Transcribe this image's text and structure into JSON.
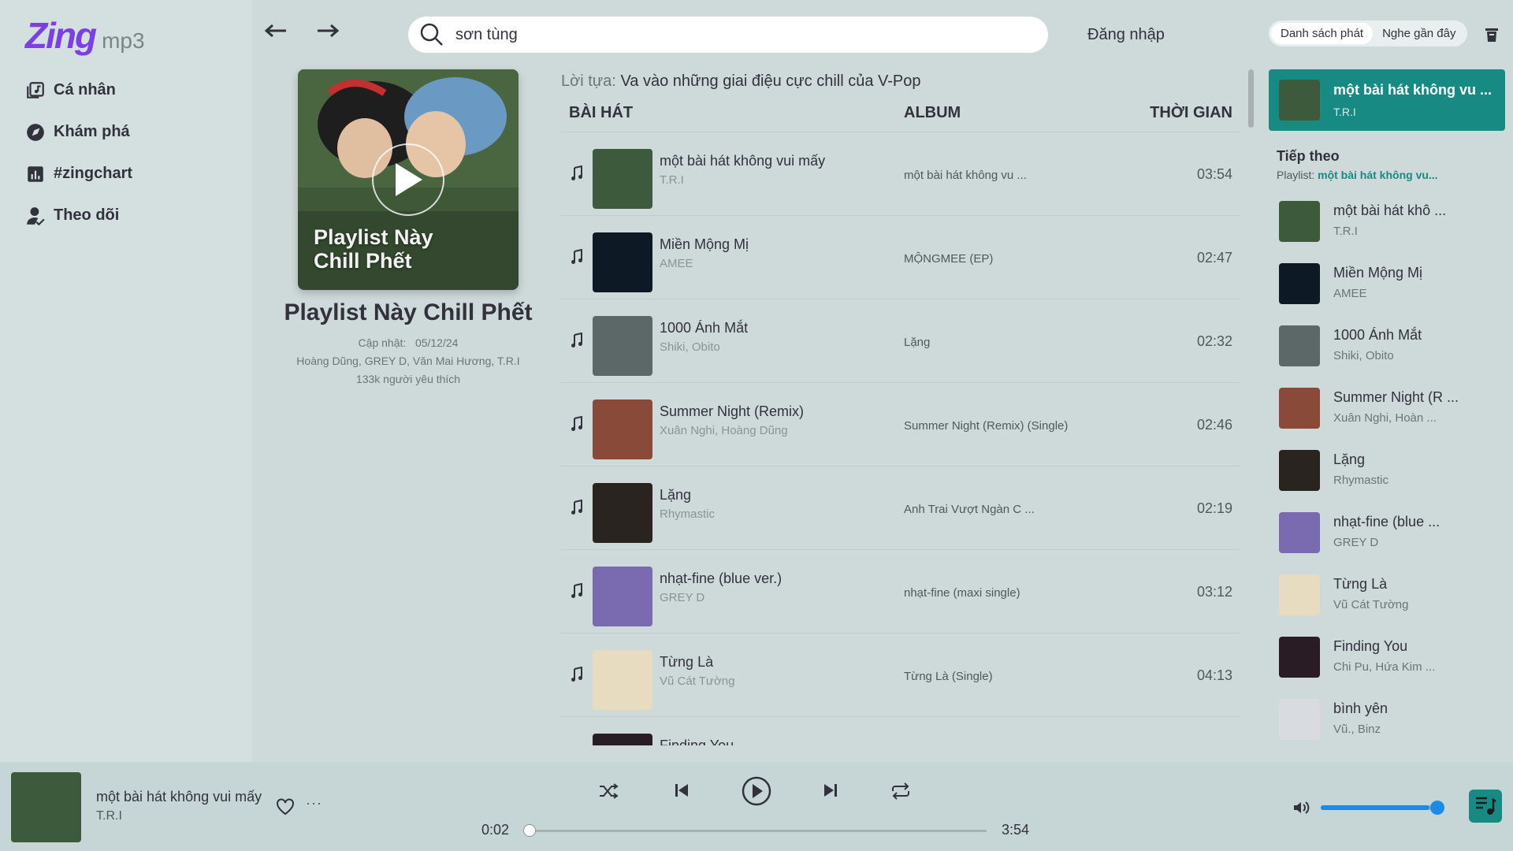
{
  "app": {
    "logo_main": "Zing",
    "logo_sub": "mp3"
  },
  "sidebar": {
    "items": [
      {
        "label": "Cá nhân",
        "icon": "library-icon"
      },
      {
        "label": "Khám phá",
        "icon": "compass-icon"
      },
      {
        "label": "#zingchart",
        "icon": "chart-icon"
      },
      {
        "label": "Theo dõi",
        "icon": "follow-icon"
      }
    ]
  },
  "topbar": {
    "search_value": "sơn tùng",
    "login_label": "Đăng nhập",
    "queue_tabs": [
      "Danh sách phát",
      "Nghe gần đây"
    ]
  },
  "playlist": {
    "cover_text_1": "Playlist Này",
    "cover_text_2": "Chill Phết",
    "title": "Playlist Này Chill Phết",
    "updated_label": "Cập nhật:",
    "updated_date": "05/12/24",
    "artists": "Hoàng Dũng, GREY D, Văn Mai Hương, T.R.I",
    "likes": "133k người yêu thích"
  },
  "songs": {
    "caption_label": "Lời tựa:",
    "caption_text": "Va vào những giai điệu cực chill của V-Pop",
    "headers": {
      "song": "BÀI HÁT",
      "album": "ALBUM",
      "time": "THỜI GIAN"
    },
    "rows": [
      {
        "title": "một bài hát không vui mấy",
        "artist": "T.R.I",
        "album": "một bài hát không vu ...",
        "duration": "03:54",
        "color": "#3e5a3c"
      },
      {
        "title": "Miền Mộng Mị",
        "artist": "AMEE",
        "album": "MỘNGMEE (EP)",
        "duration": "02:47",
        "color": "#0d1a26"
      },
      {
        "title": "1000 Ánh Mắt",
        "artist": "Shiki, Obito",
        "album": "Lặng",
        "duration": "02:32",
        "color": "#5c6868"
      },
      {
        "title": "Summer Night (Remix)",
        "artist": "Xuân Nghi, Hoàng Dũng",
        "album": "Summer Night (Remix) (Single)",
        "duration": "02:46",
        "color": "#8a4a3a"
      },
      {
        "title": "Lặng",
        "artist": "Rhymastic",
        "album": "Anh Trai Vượt Ngàn C ...",
        "duration": "02:19",
        "color": "#2a2420"
      },
      {
        "title": "nhạt-fine (blue ver.)",
        "artist": "GREY D",
        "album": "nhạt-fine (maxi single)",
        "duration": "03:12",
        "color": "#7a6ab0"
      },
      {
        "title": "Từng Là",
        "artist": "Vũ Cát Tường",
        "album": "Từng Là (Single)",
        "duration": "04:13",
        "color": "#e8dcc0"
      },
      {
        "title": "Finding You",
        "artist": "",
        "album": "",
        "duration": "",
        "color": "#2a1c24"
      }
    ]
  },
  "queue": {
    "now": {
      "title": "một bài hát không vu ...",
      "artist": "T.R.I",
      "color": "#3e5a3c"
    },
    "next_heading": "Tiếp theo",
    "playlist_label": "Playlist:",
    "playlist_name": "một bài hát không vu...",
    "items": [
      {
        "title": "một bài hát khô ...",
        "artist": "T.R.I",
        "color": "#3e5a3c"
      },
      {
        "title": "Miền Mộng Mị",
        "artist": "AMEE",
        "color": "#0d1a26"
      },
      {
        "title": "1000 Ánh Mắt",
        "artist": "Shiki, Obito",
        "color": "#5c6868"
      },
      {
        "title": "Summer Night (R ...",
        "artist": "Xuân Nghi, Hoàn ...",
        "color": "#8a4a3a"
      },
      {
        "title": "Lặng",
        "artist": "Rhymastic",
        "color": "#2a2420"
      },
      {
        "title": "nhạt-fine (blue ...",
        "artist": "GREY D",
        "color": "#7a6ab0"
      },
      {
        "title": "Từng Là",
        "artist": "Vũ Cát Tường",
        "color": "#e8dcc0"
      },
      {
        "title": "Finding You",
        "artist": "Chi Pu, Hứa Kim ...",
        "color": "#2a1c24"
      },
      {
        "title": "bình yên",
        "artist": "Vũ., Binz",
        "color": "#d8dce0"
      }
    ]
  },
  "player": {
    "title": "một bài hát không vui mấy",
    "artist": "T.R.I",
    "current_time": "0:02",
    "total_time": "3:54",
    "progress": 0.01,
    "volume": 0.92,
    "accent_color": "#178a83",
    "volume_color": "#1a8ce8"
  }
}
